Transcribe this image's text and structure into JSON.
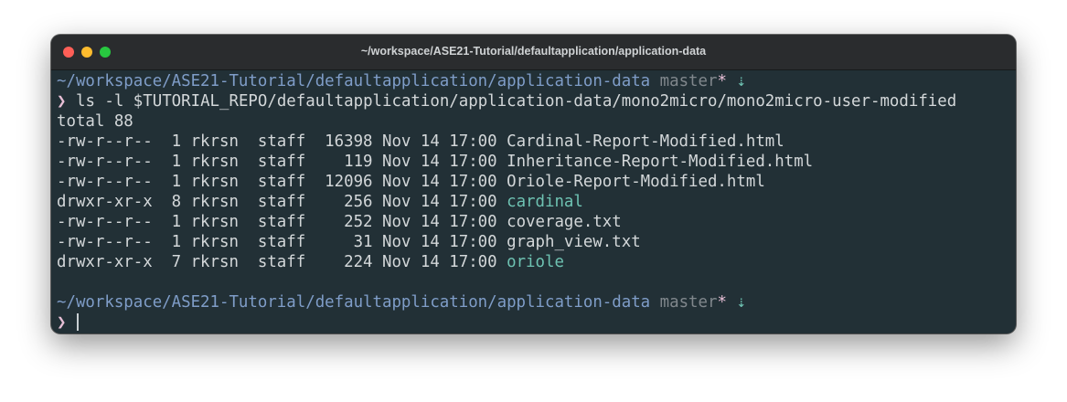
{
  "window": {
    "title": "~/workspace/ASE21-Tutorial/defaultapplication/application-data"
  },
  "prompt": {
    "path": "~/workspace/ASE21-Tutorial/defaultapplication/application-data",
    "branch": "master",
    "dirty_marker": "*",
    "arrow": "⇣",
    "symbol": "❯"
  },
  "command": "ls -l $TUTORIAL_REPO/defaultapplication/application-data/mono2micro/mono2micro-user-modified",
  "total_line": "total 88",
  "listing": [
    {
      "perms": "-rw-r--r--",
      "links": "1",
      "owner": "rkrsn",
      "group": "staff",
      "size": "16398",
      "date": "Nov 14 17:00",
      "name": "Cardinal-Report-Modified.html",
      "is_dir": false
    },
    {
      "perms": "-rw-r--r--",
      "links": "1",
      "owner": "rkrsn",
      "group": "staff",
      "size": "119",
      "date": "Nov 14 17:00",
      "name": "Inheritance-Report-Modified.html",
      "is_dir": false
    },
    {
      "perms": "-rw-r--r--",
      "links": "1",
      "owner": "rkrsn",
      "group": "staff",
      "size": "12096",
      "date": "Nov 14 17:00",
      "name": "Oriole-Report-Modified.html",
      "is_dir": false
    },
    {
      "perms": "drwxr-xr-x",
      "links": "8",
      "owner": "rkrsn",
      "group": "staff",
      "size": "256",
      "date": "Nov 14 17:00",
      "name": "cardinal",
      "is_dir": true
    },
    {
      "perms": "-rw-r--r--",
      "links": "1",
      "owner": "rkrsn",
      "group": "staff",
      "size": "252",
      "date": "Nov 14 17:00",
      "name": "coverage.txt",
      "is_dir": false
    },
    {
      "perms": "-rw-r--r--",
      "links": "1",
      "owner": "rkrsn",
      "group": "staff",
      "size": "31",
      "date": "Nov 14 17:00",
      "name": "graph_view.txt",
      "is_dir": false
    },
    {
      "perms": "drwxr-xr-x",
      "links": "7",
      "owner": "rkrsn",
      "group": "staff",
      "size": "224",
      "date": "Nov 14 17:00",
      "name": "oriole",
      "is_dir": true
    }
  ],
  "colors": {
    "background": "#223036",
    "path": "#7f9dc8",
    "branch": "#80878c",
    "prompt_symbol": "#e7bfd6",
    "directory": "#6ec2b2",
    "text": "#d3d7d9"
  }
}
